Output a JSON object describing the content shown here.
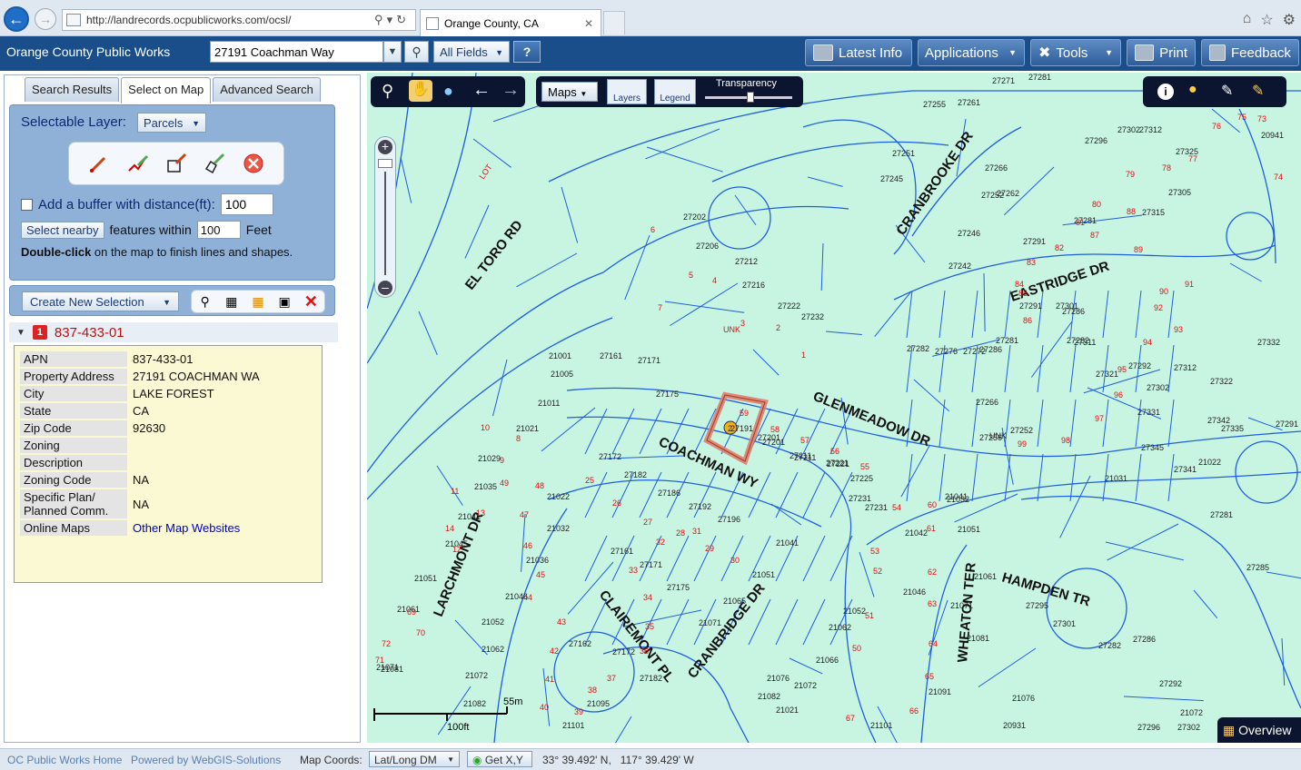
{
  "browser": {
    "url": "http://landrecords.ocpublicworks.com/ocsl/",
    "tab_title": "Orange County, CA"
  },
  "app": {
    "name": "Orange County Public Works",
    "search_value": "27191 Coachman Way",
    "fields_label": "All Fields",
    "help_label": "?",
    "buttons": [
      {
        "label": "Latest Info",
        "icon": "news-icon"
      },
      {
        "label": "Applications",
        "icon": "",
        "dropdown": true
      },
      {
        "label": "Tools",
        "icon": "tools-icon",
        "dropdown": true
      },
      {
        "label": "Print",
        "icon": "printer-icon"
      },
      {
        "label": "Feedback",
        "icon": "feedback-icon"
      }
    ]
  },
  "left": {
    "tabs": [
      "Search Results",
      "Select on Map",
      "Advanced Search"
    ],
    "active_tab": 1,
    "selectable_label": "Selectable Layer:",
    "layer_value": "Parcels",
    "buffer_label": "Add a buffer with distance(ft):",
    "buffer_value": "100",
    "select_nearby_label": "Select nearby",
    "features_within_label": "features within",
    "nearby_value": "100",
    "feet_label": "Feet",
    "hint_bold": "Double-click",
    "hint_rest": " on the map to finish lines and shapes.",
    "create_selection_label": "Create New Selection",
    "result_number": "1",
    "result_id": "837-433-01",
    "info": [
      {
        "key": "APN",
        "value": "837-433-01"
      },
      {
        "key": "Property Address",
        "value": "27191 COACHMAN WA"
      },
      {
        "key": "City",
        "value": "LAKE FOREST"
      },
      {
        "key": "State",
        "value": "CA"
      },
      {
        "key": "Zip Code",
        "value": "92630"
      },
      {
        "key": "Zoning",
        "value": ""
      },
      {
        "key": "Description",
        "value": ""
      },
      {
        "key": "Zoning Code",
        "value": "NA"
      },
      {
        "key": "Specific Plan/ Planned Comm.",
        "value": "NA"
      },
      {
        "key": "Online Maps",
        "value": "Other Map Websites",
        "link": true
      }
    ]
  },
  "map": {
    "maps_label": "Maps",
    "layers_label": "Layers",
    "legend_label": "Legend",
    "transparency_label": "Transparency",
    "overview_label": "Overview",
    "scale_m": "55m",
    "scale_ft": "100ft",
    "streets": [
      "EL TORO RD",
      "CRANBROOKE DR",
      "EASTRIDGE DR",
      "GLENMEADOW DR",
      "COACHMAN WY",
      "LARCHMONT DR",
      "CLAIREMONT PL",
      "CRANBRIDGE DR",
      "WHEATON TER",
      "HAMPDEN TR"
    ],
    "parcels": [
      "27191",
      "27201",
      "27211",
      "27221",
      "27225",
      "27231",
      "27172",
      "27182",
      "27186",
      "27192",
      "27196",
      "21041",
      "21051",
      "21065",
      "21071",
      "27175",
      "27171",
      "27161",
      "21032",
      "21036",
      "21022",
      "21029",
      "21035",
      "21041",
      "21045",
      "21051",
      "21061",
      "21071",
      "21081",
      "21062",
      "21052",
      "21046",
      "21072",
      "21082",
      "21095",
      "21101",
      "27162",
      "27172",
      "27182",
      "21001",
      "21005",
      "21011",
      "21021",
      "27161",
      "27171",
      "27175",
      "27201",
      "27211",
      "27221",
      "27231",
      "27202",
      "27206",
      "27212",
      "27216",
      "27222",
      "27232",
      "27245",
      "27251",
      "27255",
      "27261",
      "27271",
      "27281",
      "27266",
      "27262",
      "27252",
      "27246",
      "27242",
      "27291",
      "27281",
      "27296",
      "27302",
      "27305",
      "27315",
      "27325",
      "27312",
      "27286",
      "27282",
      "27292",
      "27302",
      "27312",
      "27322",
      "27332",
      "27335",
      "27341",
      "27342",
      "27345",
      "27331",
      "27321",
      "27311",
      "27301",
      "27291",
      "27281",
      "27286",
      "27282",
      "27276",
      "27272",
      "27266",
      "27256",
      "27252",
      "21031",
      "21041",
      "21051",
      "21061",
      "21071",
      "21081",
      "21091",
      "21101",
      "21032",
      "21042",
      "21046",
      "21052",
      "21062",
      "21066",
      "21072",
      "21076",
      "21082",
      "21021",
      "21025",
      "21031",
      "21022",
      "27281",
      "27285",
      "27291",
      "27295",
      "27301",
      "27282",
      "27286",
      "27292",
      "27296",
      "27302",
      "21072",
      "21076",
      "20931",
      "20941"
    ],
    "parcel_nums": [
      "59",
      "58",
      "57",
      "56",
      "55",
      "54",
      "60",
      "61",
      "62",
      "63",
      "64",
      "65",
      "66",
      "67",
      "50",
      "51",
      "52",
      "53",
      "25",
      "26",
      "27",
      "28",
      "29",
      "30",
      "31",
      "32",
      "33",
      "34",
      "35",
      "36",
      "37",
      "38",
      "39",
      "40",
      "41",
      "42",
      "43",
      "44",
      "45",
      "46",
      "47",
      "48",
      "49",
      "1",
      "2",
      "3",
      "4",
      "5",
      "6",
      "7",
      "8",
      "9",
      "10",
      "11",
      "12",
      "13",
      "14",
      "69",
      "70",
      "71",
      "72",
      "73",
      "74",
      "75",
      "76",
      "77",
      "78",
      "79",
      "80",
      "81",
      "82",
      "83",
      "84",
      "85",
      "86",
      "87",
      "88",
      "89",
      "90",
      "91",
      "92",
      "93",
      "94",
      "95",
      "96",
      "97",
      "98",
      "99"
    ],
    "unk_label": "UNK",
    "lot_label": "LOT"
  },
  "status": {
    "home_link": "OC Public Works Home",
    "powered_link": "Powered by WebGIS-Solutions",
    "coords_label": "Map Coords:",
    "coord_mode": "Lat/Long DM",
    "getxy_label": "Get X,Y",
    "coords": "33° 39.492' N,   117° 39.429' W"
  }
}
